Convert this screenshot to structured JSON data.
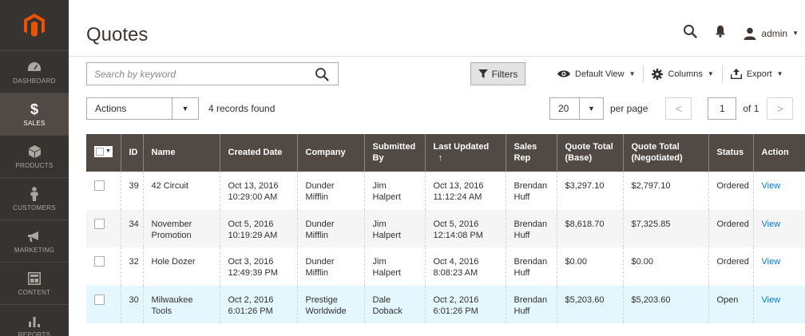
{
  "sidebar": {
    "items": [
      {
        "label": "DASHBOARD",
        "icon": "dashboard-icon",
        "active": false
      },
      {
        "label": "SALES",
        "icon": "dollar-icon",
        "active": true
      },
      {
        "label": "PRODUCTS",
        "icon": "cube-icon",
        "active": false
      },
      {
        "label": "CUSTOMERS",
        "icon": "person-icon",
        "active": false
      },
      {
        "label": "MARKETING",
        "icon": "megaphone-icon",
        "active": false
      },
      {
        "label": "CONTENT",
        "icon": "content-icon",
        "active": false
      },
      {
        "label": "REPORTS",
        "icon": "bar-chart-icon",
        "active": false
      }
    ]
  },
  "header": {
    "title": "Quotes",
    "user": "admin"
  },
  "toolbar": {
    "search_placeholder": "Search by keyword",
    "filters_label": "Filters",
    "default_view_label": "Default View",
    "columns_label": "Columns",
    "export_label": "Export",
    "actions_label": "Actions",
    "records_found": "4 records found",
    "per_page_value": "20",
    "per_page_label": "per page",
    "current_page": "1",
    "page_of": "of 1"
  },
  "table": {
    "columns": [
      "ID",
      "Name",
      "Created Date",
      "Company",
      "Submitted By",
      "Last Updated",
      "Sales Rep",
      "Quote Total (Base)",
      "Quote Total (Negotiated)",
      "Status",
      "Action"
    ],
    "sort_indicator": "↑",
    "rows": [
      {
        "id": "39",
        "name": "42 Circuit",
        "created": "Oct 13, 2016 10:29:00 AM",
        "company": "Dunder Mifflin",
        "submitted_by": "Jim Halpert",
        "updated": "Oct 13, 2016 11:12:24 AM",
        "sales_rep": "Brendan Huff",
        "total_base": "$3,297.10",
        "total_negotiated": "$2,797.10",
        "status": "Ordered",
        "action": "View"
      },
      {
        "id": "34",
        "name": "November Promotion",
        "created": "Oct 5, 2016 10:19:29 AM",
        "company": "Dunder Mifflin",
        "submitted_by": "Jim Halpert",
        "updated": "Oct 5, 2016 12:14:08 PM",
        "sales_rep": "Brendan Huff",
        "total_base": "$8,618.70",
        "total_negotiated": "$7,325.85",
        "status": "Ordered",
        "action": "View"
      },
      {
        "id": "32",
        "name": "Hole Dozer",
        "created": "Oct 3, 2016 12:49:39 PM",
        "company": "Dunder Mifflin",
        "submitted_by": "Jim Halpert",
        "updated": "Oct 4, 2016 8:08:23 AM",
        "sales_rep": "Brendan Huff",
        "total_base": "$0.00",
        "total_negotiated": "$0.00",
        "status": "Ordered",
        "action": "View"
      },
      {
        "id": "30",
        "name": "Milwaukee Tools",
        "created": "Oct 2, 2016 6:01:26 PM",
        "company": "Prestige Worldwide",
        "submitted_by": "Dale Doback",
        "updated": "Oct 2, 2016 6:01:26 PM",
        "sales_rep": "Brendan Huff",
        "total_base": "$5,203.60",
        "total_negotiated": "$5,203.60",
        "status": "Open",
        "action": "View"
      }
    ]
  },
  "colors": {
    "sidebar_bg": "#373330",
    "sidebar_active": "#514943",
    "header_row": "#514943",
    "logo_orange": "#eb5202",
    "link": "#007bdb",
    "highlight_row": "#e5f7fe"
  }
}
